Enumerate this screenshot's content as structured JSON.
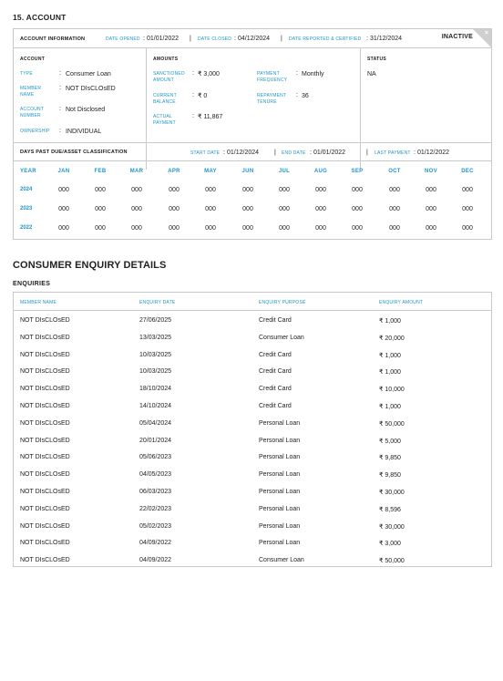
{
  "account": {
    "section_title": "15. ACCOUNT",
    "info_label": "ACCOUNT INFORMATION",
    "date_opened_label": "DATE OPENED",
    "date_opened": "01/01/2022",
    "date_closed_label": "DATE CLOSED",
    "date_closed": "04/12/2024",
    "date_reported_label": "DATE REPORTED & CERTIFIED",
    "date_reported": "31/12/2024",
    "status_tag": "INACTIVE",
    "close_glyph": "×",
    "account_col": {
      "heading": "ACCOUNT",
      "type_label": "TYPE",
      "type_value": "Consumer Loan",
      "member_label": "MEMBER NAME",
      "member_value": "NOT DIsCLOsED",
      "number_label": "ACCOUNT NUMBER",
      "number_value": "Not Disclosed",
      "ownership_label": "OWNERSHIP",
      "ownership_value": "INDIVIDUAL"
    },
    "amounts_col": {
      "heading": "AMOUNTS",
      "sanctioned_label": "SANCTIONED AMOUNT",
      "sanctioned_value": "₹ 3,000",
      "current_label": "CURRENT BALANCE",
      "current_value": "₹ 0",
      "actual_label": "ACTUAL PAYMENT",
      "actual_value": "₹ 11,867",
      "frequency_label": "PAYMENT FREQUENCY",
      "frequency_value": "Monthly",
      "tenure_label": "REPAYMENT TENURE",
      "tenure_value": "36"
    },
    "status_col": {
      "heading": "STATUS",
      "value": "NA"
    },
    "colon": ":",
    "separator": "|",
    "dpd": {
      "label": "DAYS PAST DUE/ASSET CLASSIFICATION",
      "start_label": "START DATE",
      "start_value": "01/12/2024",
      "end_label": "END DATE",
      "end_value": "01/01/2022",
      "last_label": "LAST PAYMENT",
      "last_value": "01/12/2022",
      "year_header": "YEAR",
      "months": [
        "JAN",
        "FEB",
        "MAR",
        "APR",
        "MAY",
        "JUN",
        "JUL",
        "AUG",
        "SEP",
        "OCT",
        "NOV",
        "DEC"
      ],
      "rows": [
        {
          "year": "2024",
          "values": [
            "000",
            "000",
            "000",
            "000",
            "000",
            "000",
            "000",
            "000",
            "000",
            "000",
            "000",
            "000"
          ]
        },
        {
          "year": "2023",
          "values": [
            "000",
            "000",
            "000",
            "000",
            "000",
            "000",
            "000",
            "000",
            "000",
            "000",
            "000",
            "000"
          ]
        },
        {
          "year": "2022",
          "values": [
            "000",
            "000",
            "000",
            "000",
            "000",
            "000",
            "000",
            "000",
            "000",
            "000",
            "000",
            "000"
          ]
        }
      ]
    }
  },
  "enquiry": {
    "title": "CONSUMER ENQUIRY DETAILS",
    "subtitle": "ENQUIRIES",
    "columns": [
      "MEMBER NAME",
      "ENQUIRY DATE",
      "ENQUIRY PURPOSE",
      "ENQUIRY AMOUNT"
    ],
    "rows": [
      [
        "NOT DIsCLOsED",
        "27/06/2025",
        "Credit Card",
        "₹ 1,000"
      ],
      [
        "NOT DIsCLOsED",
        "13/03/2025",
        "Consumer Loan",
        "₹ 20,000"
      ],
      [
        "NOT DIsCLOsED",
        "10/03/2025",
        "Credit Card",
        "₹ 1,000"
      ],
      [
        "NOT DIsCLOsED",
        "10/03/2025",
        "Credit Card",
        "₹ 1,000"
      ],
      [
        "NOT DIsCLOsED",
        "18/10/2024",
        "Credit Card",
        "₹ 10,000"
      ],
      [
        "NOT DIsCLOsED",
        "14/10/2024",
        "Credit Card",
        "₹ 1,000"
      ],
      [
        "NOT DIsCLOsED",
        "05/04/2024",
        "Personal Loan",
        "₹ 50,000"
      ],
      [
        "NOT DIsCLOsED",
        "20/01/2024",
        "Personal Loan",
        "₹ 5,000"
      ],
      [
        "NOT DIsCLOsED",
        "05/06/2023",
        "Personal Loan",
        "₹ 9,850"
      ],
      [
        "NOT DIsCLOsED",
        "04/05/2023",
        "Personal Loan",
        "₹ 9,850"
      ],
      [
        "NOT DIsCLOsED",
        "06/03/2023",
        "Personal Loan",
        "₹ 30,000"
      ],
      [
        "NOT DIsCLOsED",
        "22/02/2023",
        "Personal Loan",
        "₹ 8,596"
      ],
      [
        "NOT DIsCLOsED",
        "05/02/2023",
        "Personal Loan",
        "₹ 30,000"
      ],
      [
        "NOT DIsCLOsED",
        "04/09/2022",
        "Personal Loan",
        "₹ 3,000"
      ],
      [
        "NOT DIsCLOsED",
        "04/09/2022",
        "Consumer Loan",
        "₹ 50,000"
      ]
    ]
  }
}
